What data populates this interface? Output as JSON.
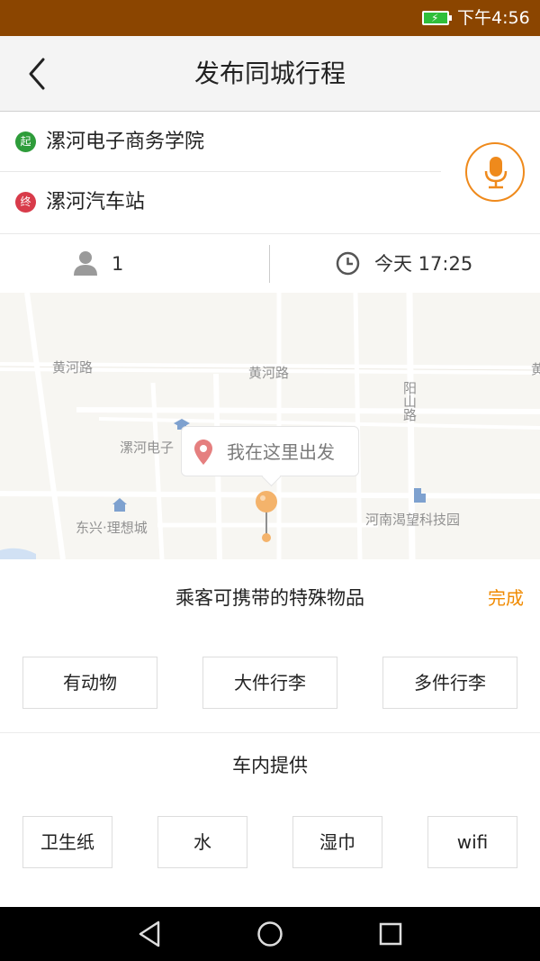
{
  "status_bar": {
    "time": "下午4:56"
  },
  "header": {
    "title": "发布同城行程"
  },
  "route": {
    "start": {
      "badge": "起",
      "name": "漯河电子商务学院"
    },
    "end": {
      "badge": "终",
      "name": "漯河汽车站"
    },
    "passengers": "1",
    "departure_time": "今天 17:25"
  },
  "map": {
    "labels": {
      "road1": "黄河路",
      "road2": "黄河路",
      "road3": "阳山路",
      "poi1": "漯河电子",
      "poi2": "东兴·理想城",
      "poi3": "河南渴望科技园",
      "edge": "黄"
    },
    "bubble_text": "我在这里出发"
  },
  "sheet": {
    "title": "乘客可携带的特殊物品",
    "done": "完成",
    "items": [
      "有动物",
      "大件行李",
      "多件行李"
    ],
    "section2_title": "车内提供",
    "provided": [
      "卫生纸",
      "水",
      "湿巾",
      "wifi"
    ]
  },
  "colors": {
    "accent": "#f08a00",
    "status_bar": "#8b4500",
    "start_dot": "#2e9c3a",
    "end_dot": "#d83b4a"
  }
}
